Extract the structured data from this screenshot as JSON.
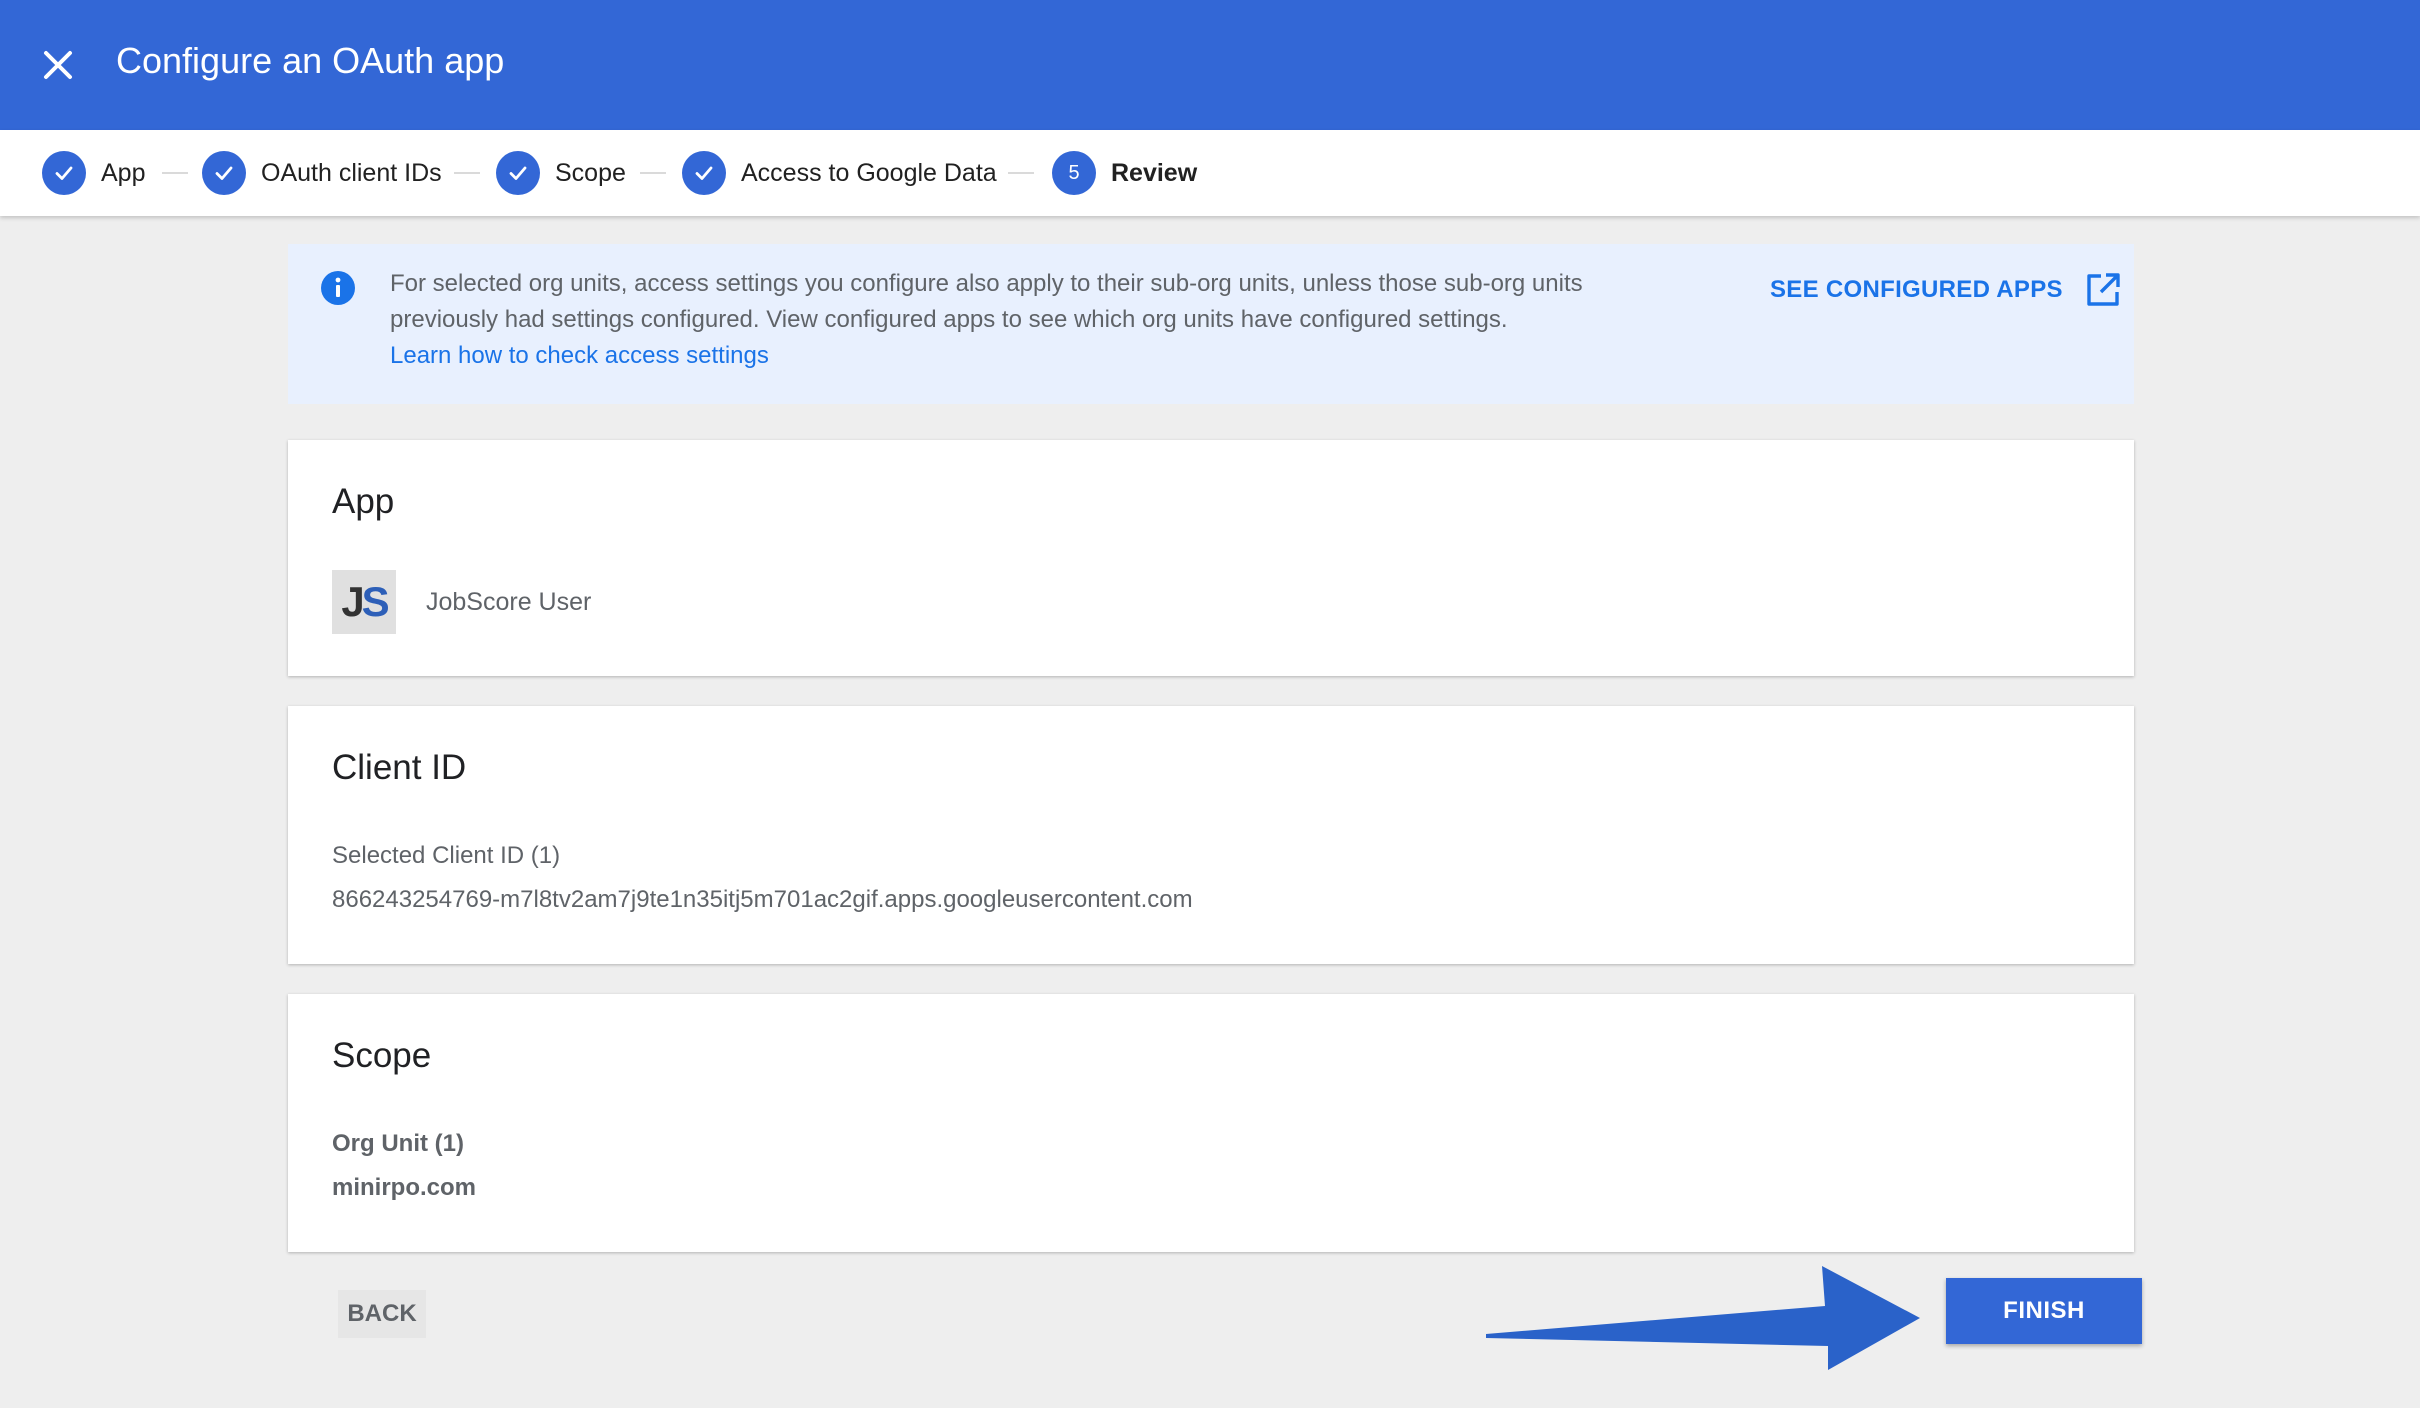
{
  "header": {
    "title": "Configure an OAuth app",
    "close_icon": "close-icon"
  },
  "stepper": {
    "steps": [
      {
        "label": "App",
        "state": "done"
      },
      {
        "label": "OAuth client IDs",
        "state": "done"
      },
      {
        "label": "Scope",
        "state": "done"
      },
      {
        "label": "Access to Google Data",
        "state": "done"
      },
      {
        "label": "Review",
        "state": "active",
        "number": "5"
      }
    ]
  },
  "info_banner": {
    "text": "For selected org units, access settings you configure also apply to their sub-org units, unless those sub-org units previously had settings configured. View configured apps to see which org units have configured settings.",
    "link": "Learn how to check access settings",
    "action": "SEE CONFIGURED APPS"
  },
  "app_card": {
    "title": "App",
    "app_name": "JobScore User",
    "logo_text": "JS"
  },
  "client_card": {
    "title": "Client ID",
    "selected_label": "Selected Client ID (1)",
    "client_id": "866243254769-m7l8tv2am7j9te1n35itj5m701ac2gif.apps.googleusercontent.com"
  },
  "scope_card": {
    "title": "Scope",
    "org_unit_label": "Org Unit (1)",
    "org_unit_value": "minirpo.com"
  },
  "footer": {
    "back_label": "BACK",
    "finish_label": "FINISH"
  },
  "colors": {
    "primary": "#3367d6",
    "link": "#1a73e8",
    "banner_bg": "#e8f0fe",
    "page_bg": "#eeeeee"
  }
}
